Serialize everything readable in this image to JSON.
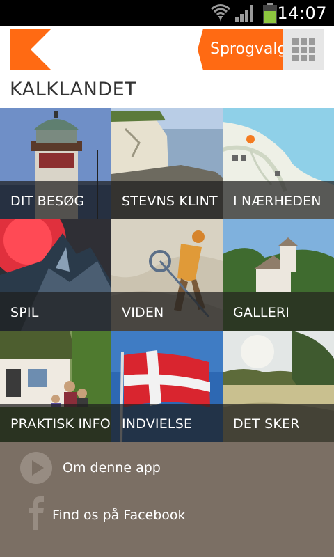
{
  "status_bar": {
    "time": "14:07",
    "icons": [
      "wifi-icon",
      "signal-icon",
      "battery-icon"
    ],
    "battery_color": "#8dc63f"
  },
  "header": {
    "logo": "k-logo-icon",
    "language_button": "Sprogvalg",
    "grid_icon": "grid-icon",
    "accent_color": "#ff6a13"
  },
  "page_title": "KALKLANDET",
  "tiles": [
    {
      "label": "DIT BESØG"
    },
    {
      "label": "STEVNS KLINT"
    },
    {
      "label": "I NÆRHEDEN"
    },
    {
      "label": "SPIL"
    },
    {
      "label": "VIDEN"
    },
    {
      "label": "GALLERI"
    },
    {
      "label": "PRAKTISK INFO"
    },
    {
      "label": "INDVIELSE"
    },
    {
      "label": "DET SKER"
    }
  ],
  "footer": {
    "items": [
      {
        "label": "Om denne app",
        "icon": "play-icon"
      },
      {
        "label": "Find os på Facebook",
        "icon": "facebook-icon"
      }
    ],
    "background": "#7b6f64"
  }
}
